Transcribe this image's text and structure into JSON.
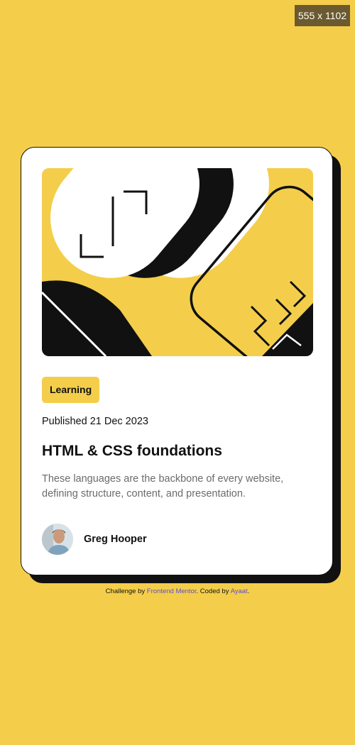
{
  "viewport_badge": "555 x 1102",
  "card": {
    "tag": "Learning",
    "published": "Published 21 Dec 2023",
    "title": "HTML & CSS foundations",
    "description": "These languages are the backbone of every website, defining structure, content, and presentation.",
    "author_name": "Greg Hooper"
  },
  "footer": {
    "prefix": "Challenge by ",
    "challenge_link": "Frontend Mentor",
    "middle": ". Coded by ",
    "coder_link": "Ayaat",
    "suffix": "."
  },
  "colors": {
    "background": "#F4CE4B",
    "card": "#FFFFFF",
    "text": "#111111",
    "muted": "#6b6b6b",
    "link": "#5a4fd0"
  }
}
